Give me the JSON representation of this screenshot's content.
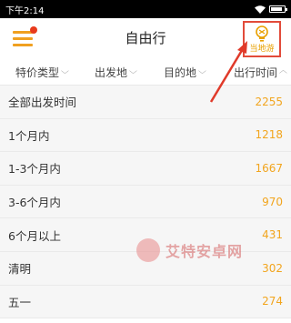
{
  "status_bar": {
    "time": "下午2:14"
  },
  "header": {
    "title": "自由行",
    "local_button_label": "当地游"
  },
  "filters": [
    {
      "label": "特价类型"
    },
    {
      "label": "出发地"
    },
    {
      "label": "目的地"
    },
    {
      "label": "出行时间"
    }
  ],
  "rows": [
    {
      "label": "全部出发时间",
      "count": "2255"
    },
    {
      "label": "1个月内",
      "count": "1218"
    },
    {
      "label": "1-3个月内",
      "count": "1667"
    },
    {
      "label": "3-6个月内",
      "count": "970"
    },
    {
      "label": "6个月以上",
      "count": "431"
    },
    {
      "label": "清明",
      "count": "302"
    },
    {
      "label": "五一",
      "count": "274"
    }
  ],
  "watermark": {
    "text": "艾特安卓网"
  },
  "colors": {
    "accent": "#f2a51e",
    "highlight_border": "#e24b3a",
    "arrow": "#e03a2a"
  }
}
